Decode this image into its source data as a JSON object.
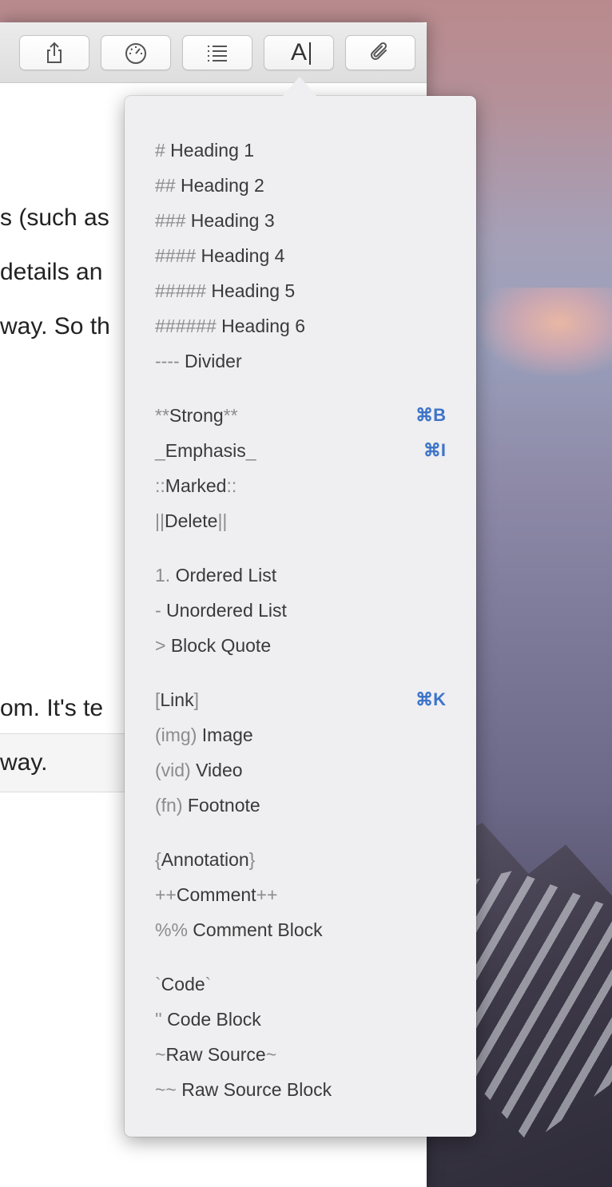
{
  "toolbar": {
    "buttons": [
      {
        "name": "share",
        "icon": "share-icon"
      },
      {
        "name": "stats",
        "icon": "speedometer-icon"
      },
      {
        "name": "outline",
        "icon": "list-icon"
      },
      {
        "name": "format",
        "icon": "font-a-icon",
        "label": "A",
        "active": true
      },
      {
        "name": "attach",
        "icon": "paperclip-icon"
      }
    ]
  },
  "document": {
    "lines": [
      "s (such as",
      "details an",
      "way. So th",
      "om. It's te",
      "way."
    ]
  },
  "format_menu": {
    "groups": [
      {
        "items": [
          {
            "marker": "#",
            "label": " Heading 1"
          },
          {
            "marker": "##",
            "label": " Heading 2"
          },
          {
            "marker": "###",
            "label": " Heading 3"
          },
          {
            "marker": "####",
            "label": " Heading 4"
          },
          {
            "marker": "#####",
            "label": " Heading 5"
          },
          {
            "marker": "######",
            "label": " Heading 6"
          },
          {
            "marker": "----",
            "label": " Divider"
          }
        ]
      },
      {
        "items": [
          {
            "marker": "**",
            "label": "Strong",
            "marker_end": "**",
            "shortcut": "⌘B"
          },
          {
            "marker": "_",
            "label": "Emphasis",
            "marker_end": "_",
            "shortcut": "⌘I"
          },
          {
            "marker": "::",
            "label": "Marked",
            "marker_end": "::"
          },
          {
            "marker": "||",
            "label": "Delete",
            "marker_end": "||"
          }
        ]
      },
      {
        "items": [
          {
            "marker": "1.",
            "label": " Ordered List"
          },
          {
            "marker": "-",
            "label": " Unordered List"
          },
          {
            "marker": ">",
            "label": " Block Quote"
          }
        ]
      },
      {
        "items": [
          {
            "marker": "[",
            "label": "Link",
            "marker_end": "]",
            "shortcut": "⌘K"
          },
          {
            "marker": "(img)",
            "label": " Image"
          },
          {
            "marker": "(vid)",
            "label": " Video"
          },
          {
            "marker": "(fn)",
            "label": " Footnote"
          }
        ]
      },
      {
        "items": [
          {
            "marker": "{",
            "label": "Annotation",
            "marker_end": "}"
          },
          {
            "marker": "++",
            "label": "Comment",
            "marker_end": "++"
          },
          {
            "marker": "%%",
            "label": " Comment Block"
          }
        ]
      },
      {
        "items": [
          {
            "marker": "`",
            "label": "Code",
            "marker_end": "`"
          },
          {
            "marker": "''",
            "label": " Code Block"
          },
          {
            "marker": "~",
            "label": "Raw Source",
            "marker_end": "~"
          },
          {
            "marker": "~~",
            "label": " Raw Source Block"
          }
        ]
      }
    ]
  },
  "colors": {
    "shortcut": "#3d74c9",
    "marker": "#8c8c8c",
    "label": "#3a3a3a"
  }
}
